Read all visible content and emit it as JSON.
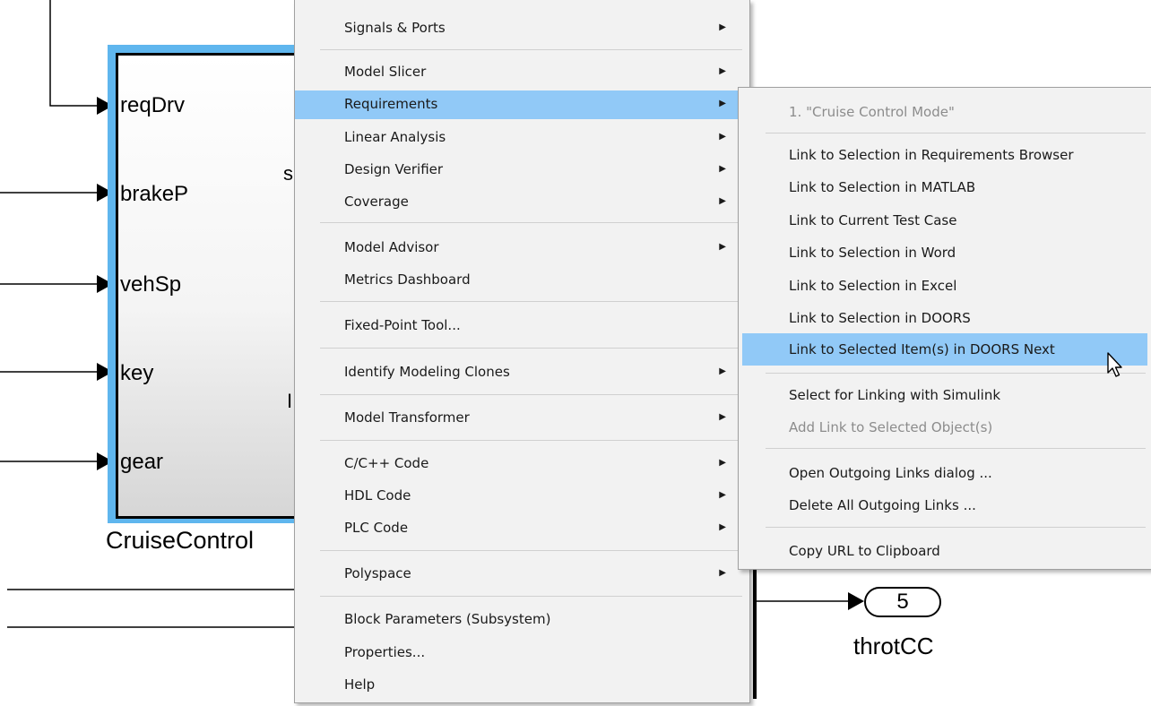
{
  "canvas": {
    "inports": [
      "reqDrv",
      "brakeP",
      "vehSp",
      "key",
      "gear"
    ],
    "block_name": "CruiseControl",
    "outport_number": "5",
    "outport_name": "throtCC",
    "partial_text_1": "s",
    "partial_text_2": "I"
  },
  "context_menu": {
    "items": [
      {
        "label": "Signals & Ports",
        "submenu": true
      },
      {
        "label": "Model Slicer",
        "submenu": true
      },
      {
        "label": "Requirements",
        "submenu": true,
        "highlighted": true
      },
      {
        "label": "Linear Analysis",
        "submenu": true
      },
      {
        "label": "Design Verifier",
        "submenu": true
      },
      {
        "label": "Coverage",
        "submenu": true
      },
      {
        "label": "Model Advisor",
        "submenu": true
      },
      {
        "label": "Metrics Dashboard",
        "submenu": false
      },
      {
        "label": "Fixed-Point Tool...",
        "submenu": false
      },
      {
        "label": "Identify Modeling Clones",
        "submenu": true
      },
      {
        "label": "Model Transformer",
        "submenu": true
      },
      {
        "label": "C/C++ Code",
        "submenu": true
      },
      {
        "label": "HDL Code",
        "submenu": true
      },
      {
        "label": "PLC Code",
        "submenu": true
      },
      {
        "label": "Polyspace",
        "submenu": true
      },
      {
        "label": "Block Parameters (Subsystem)",
        "submenu": false
      },
      {
        "label": "Properties...",
        "submenu": false
      },
      {
        "label": "Help",
        "submenu": false
      }
    ],
    "submenu_arrow_glyph": "▶"
  },
  "requirements_submenu": {
    "items": [
      {
        "label": "1. \"Cruise Control Mode\"",
        "enabled": false
      },
      {
        "label": "Link to Selection in Requirements Browser",
        "enabled": true
      },
      {
        "label": "Link to Selection in MATLAB",
        "enabled": true
      },
      {
        "label": "Link to Current Test Case",
        "enabled": true
      },
      {
        "label": "Link to Selection in Word",
        "enabled": true
      },
      {
        "label": "Link to Selection in Excel",
        "enabled": true
      },
      {
        "label": "Link to Selection in DOORS",
        "enabled": true
      },
      {
        "label": "Link to Selected Item(s) in DOORS Next",
        "enabled": true,
        "highlighted": true
      },
      {
        "label": "Select for Linking with Simulink",
        "enabled": true
      },
      {
        "label": "Add Link to Selected Object(s)",
        "enabled": false
      },
      {
        "label": "Open Outgoing Links dialog ...",
        "enabled": true
      },
      {
        "label": "Delete All Outgoing Links ...",
        "enabled": true
      },
      {
        "label": "Copy URL to Clipboard",
        "enabled": true
      }
    ]
  },
  "colors": {
    "menu_background": "#f2f2f2",
    "highlight": "#91c9f7",
    "block_selection": "#5fb6ee",
    "disabled_text": "#8c8c8c"
  },
  "icons": {
    "cursor": "mouse-pointer-icon",
    "submenu_arrow": "triangle-right-icon"
  }
}
